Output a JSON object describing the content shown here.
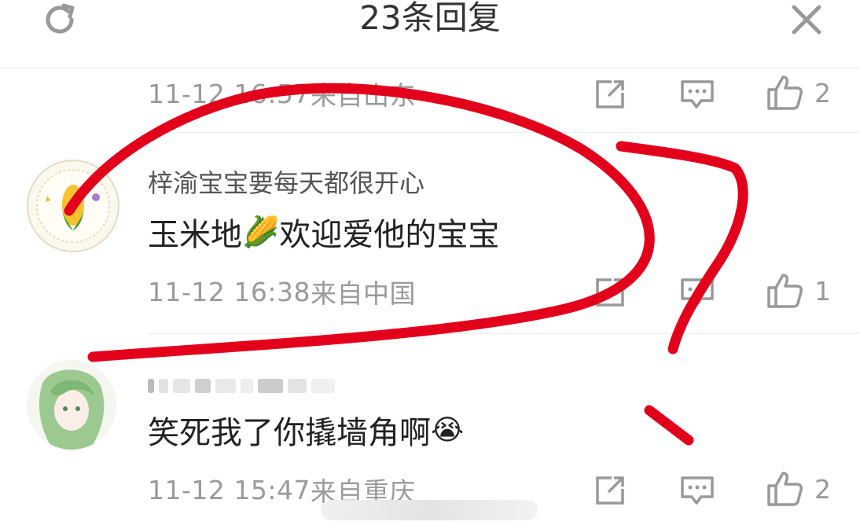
{
  "header": {
    "title": "23条回复",
    "refresh_icon": "refresh-icon",
    "close_icon": "close-icon"
  },
  "comments": [
    {
      "time": "11-12 16:57",
      "location": "来自山东",
      "like_count": "2"
    },
    {
      "username": "梓渝宝宝要每天都很开心",
      "text_before": "玉米地",
      "emoji": "🌽",
      "text_after": "欢迎爱他的宝宝",
      "time": "11-12 16:38",
      "location": "来自中国",
      "like_count": "1"
    },
    {
      "username": "",
      "text": "笑死我了你撬墙角啊",
      "emoji": "😭",
      "time": "11-12 15:47",
      "location": "来自重庆",
      "like_count": "2"
    }
  ],
  "colors": {
    "scribble": "#e3001b",
    "meta_gray": "#9a9a9a",
    "divider": "#eeeeee"
  }
}
